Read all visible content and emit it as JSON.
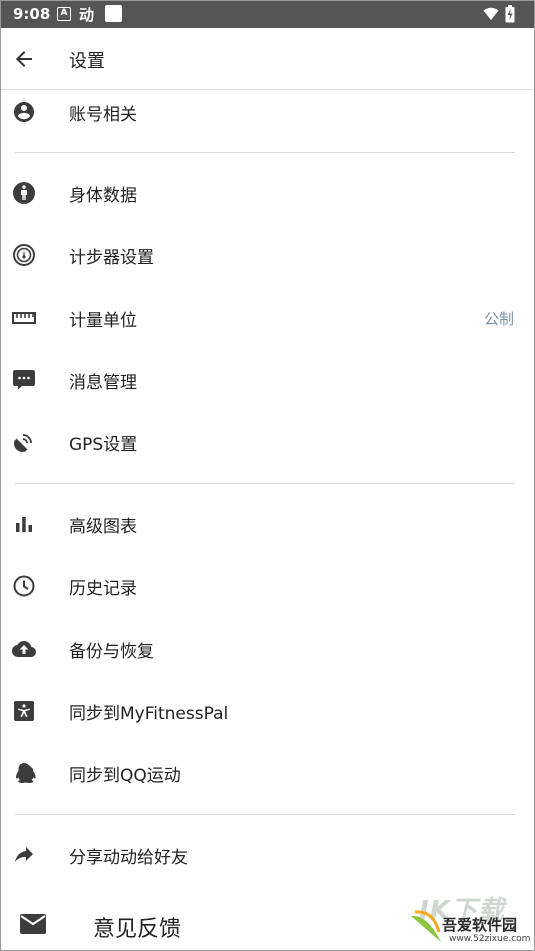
{
  "status_bar": {
    "time": "9:08",
    "notif_a": "A",
    "notif_app": "动"
  },
  "app_bar": {
    "title": "设置",
    "back_icon": "arrow-left-icon"
  },
  "sections": [
    [
      {
        "label": "账号相关",
        "icon": "account-circle-icon",
        "value": ""
      }
    ],
    [
      {
        "label": "身体数据",
        "icon": "body-person-icon",
        "value": ""
      },
      {
        "label": "计步器设置",
        "icon": "gauge-icon",
        "value": ""
      },
      {
        "label": "计量单位",
        "icon": "ruler-icon",
        "value": "公制"
      },
      {
        "label": "消息管理",
        "icon": "message-icon",
        "value": ""
      },
      {
        "label": "GPS设置",
        "icon": "satellite-icon",
        "value": ""
      }
    ],
    [
      {
        "label": "高级图表",
        "icon": "bar-chart-icon",
        "value": ""
      },
      {
        "label": "历史记录",
        "icon": "clock-icon",
        "value": ""
      },
      {
        "label": "备份与恢复",
        "icon": "cloud-upload-icon",
        "value": ""
      },
      {
        "label": "同步到MyFitnessPal",
        "icon": "myfitnesspal-icon",
        "value": ""
      },
      {
        "label": "同步到QQ运动",
        "icon": "qq-penguin-icon",
        "value": ""
      }
    ],
    [
      {
        "label": "分享动动给好友",
        "icon": "share-arrow-icon",
        "value": ""
      }
    ]
  ],
  "feedback": {
    "label": "意见反馈",
    "icon": "envelope-icon"
  },
  "watermark": {
    "brand": "吾爱软件园",
    "url": "www.52zixue.com",
    "big": "IK下载"
  },
  "colors": {
    "status_bar": "#555555",
    "icon": "#3c3c3c",
    "value_text": "#7a94a8",
    "divider": "#dcdcdc"
  }
}
